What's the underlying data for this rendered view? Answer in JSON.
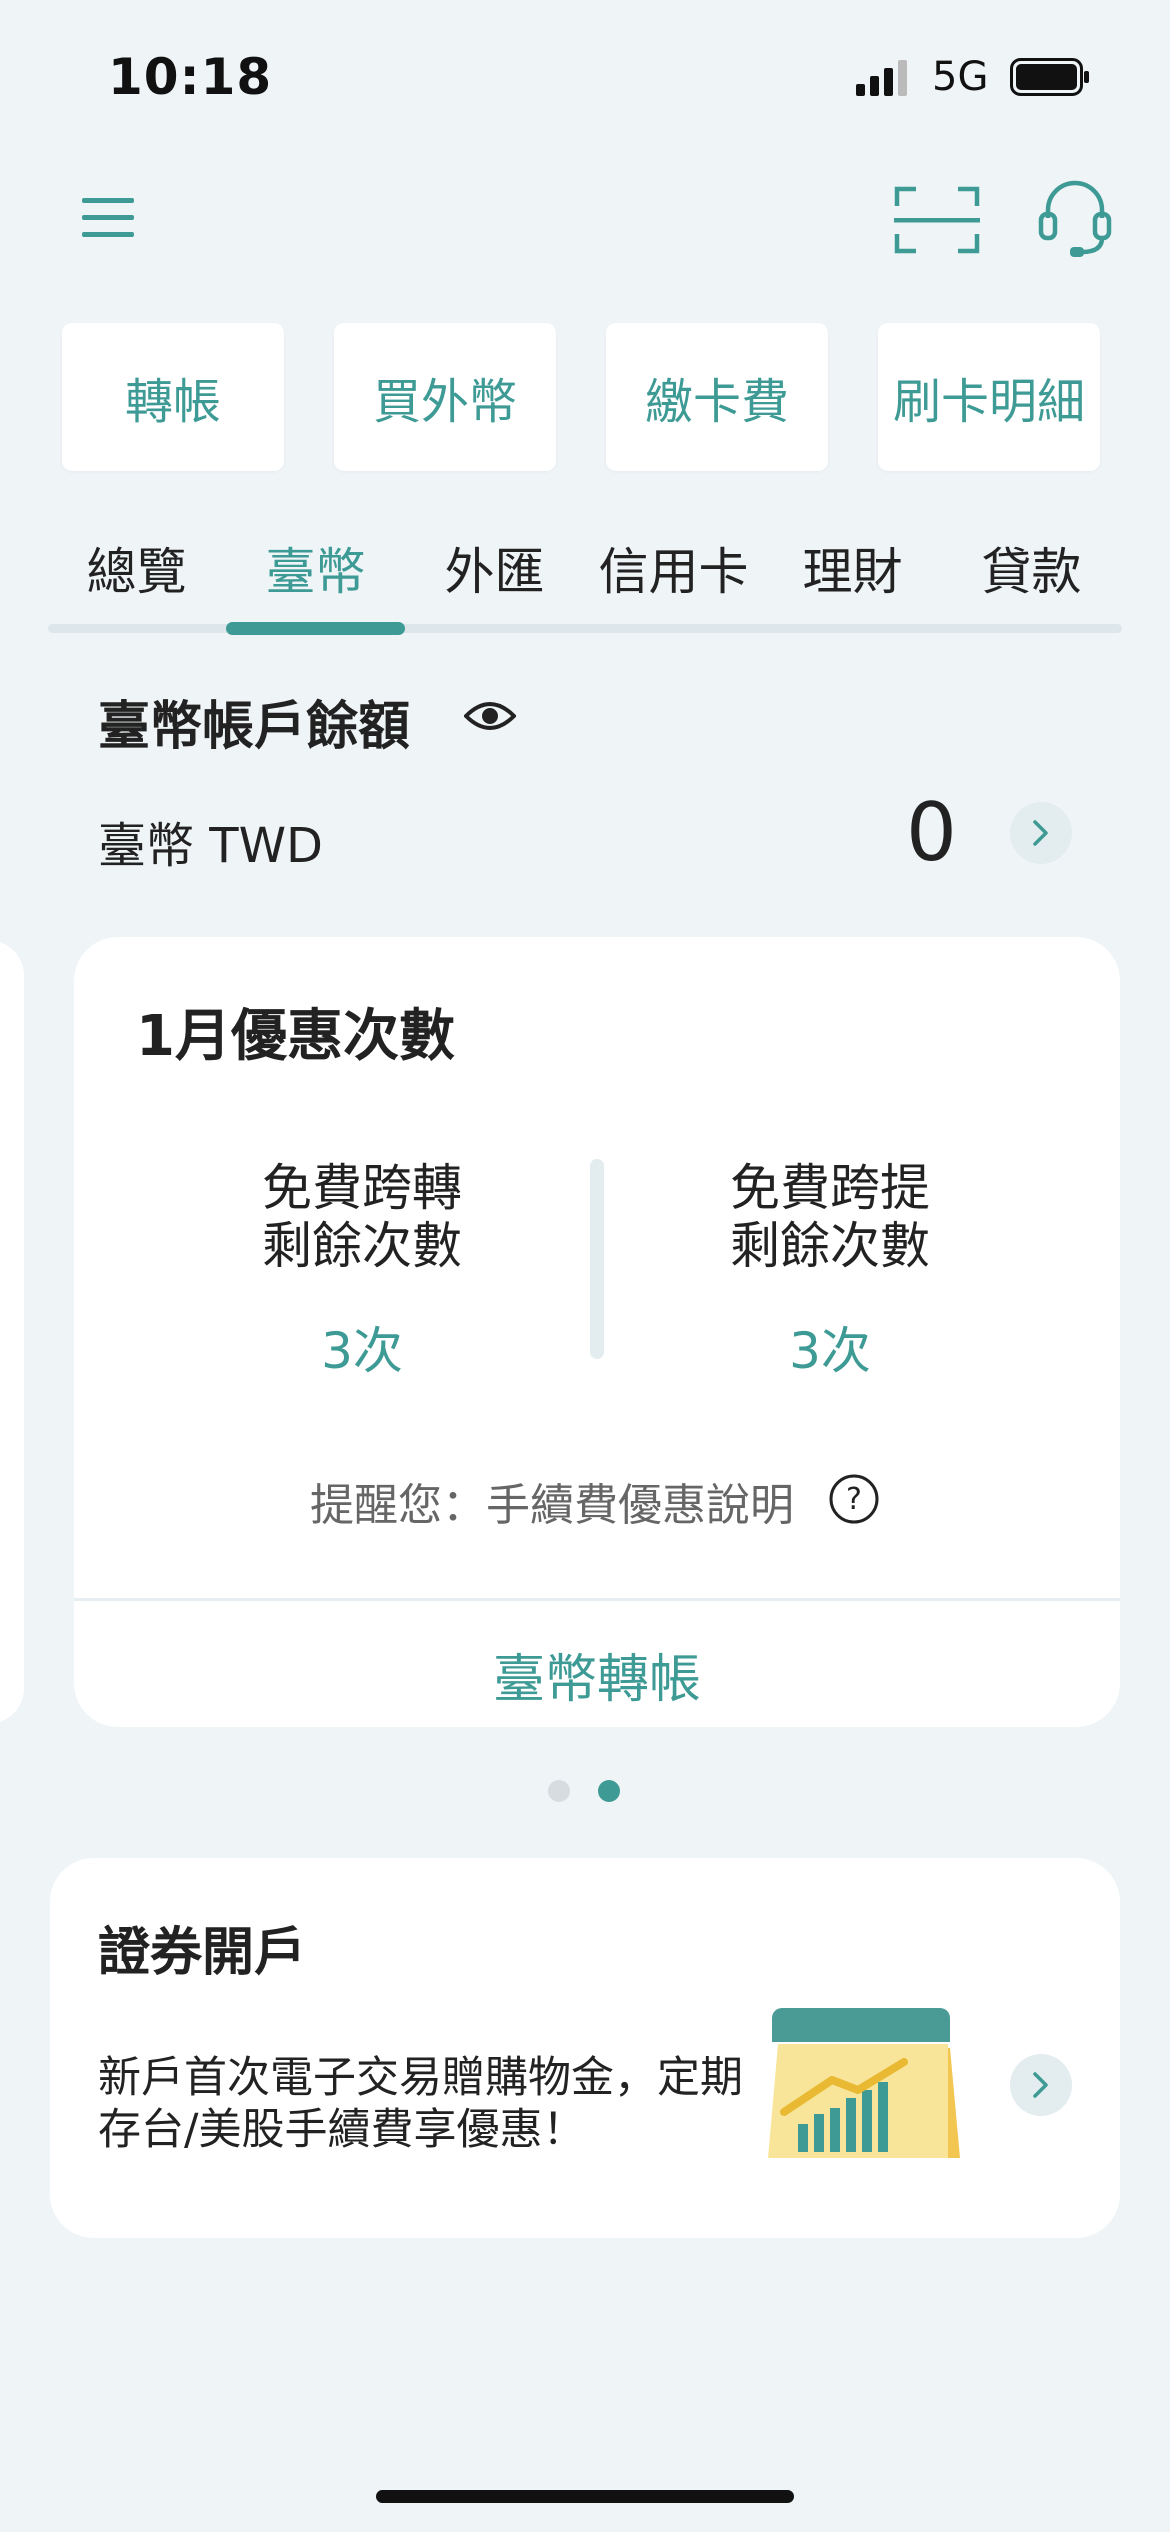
{
  "status_bar": {
    "time": "10:18",
    "network": "5G"
  },
  "quick_actions": [
    "轉帳",
    "買外幣",
    "繳卡費",
    "刷卡明細"
  ],
  "tabs": [
    "總覽",
    "臺幣",
    "外匯",
    "信用卡",
    "理財",
    "貸款"
  ],
  "active_tab": "臺幣",
  "balance": {
    "title": "臺幣帳戶餘額",
    "currency_label": "臺幣 TWD",
    "amount": "0"
  },
  "promo_card": {
    "title": "1月優惠次數",
    "left": {
      "label_line1": "免費跨轉",
      "label_line2": "剩餘次數",
      "value": "3次"
    },
    "right": {
      "label_line1": "免費跨提",
      "label_line2": "剩餘次數",
      "value": "3次"
    },
    "reminder": "提醒您：手續費優惠說明",
    "link": "臺幣轉帳"
  },
  "pager": {
    "total": 2,
    "active_index": 1
  },
  "securities_card": {
    "title": "證券開戶",
    "description": "新戶首次電子交易贈購物金，定期存台/美股手續費享優惠！"
  },
  "colors": {
    "accent": "#3e9a94",
    "background": "#eff4f7",
    "card": "#ffffff",
    "illustration_yellow": "#f9e59a"
  },
  "icons": [
    "signal-icon",
    "battery-icon",
    "menu-icon",
    "scan-icon",
    "support-icon",
    "eye-icon",
    "chevron-right-icon",
    "help-icon",
    "chart-illustration"
  ]
}
